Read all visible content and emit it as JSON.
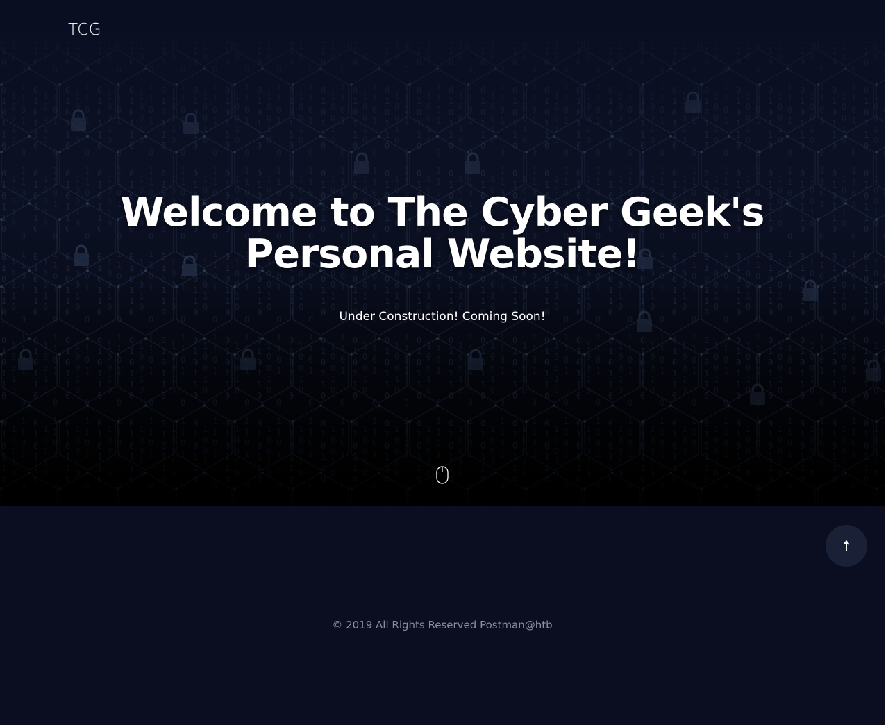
{
  "header": {
    "brand": "TCG"
  },
  "hero": {
    "title_line1": "Welcome to The Cyber Geek's",
    "title_line2": "Personal Website!",
    "subtitle": "Under Construction! Coming Soon!",
    "scroll_icon": "mouse-scroll-icon"
  },
  "back_to_top": {
    "icon": "arrow-up-icon",
    "label": "↑"
  },
  "footer": {
    "copyright": "© 2019 All Rights Reserved Postman@htb"
  },
  "colors": {
    "background": "#0a0e20",
    "hero_dark": "#05070f",
    "text": "#ffffff",
    "footer_text": "#8a8f9e",
    "button_bg": "#1a2036"
  }
}
